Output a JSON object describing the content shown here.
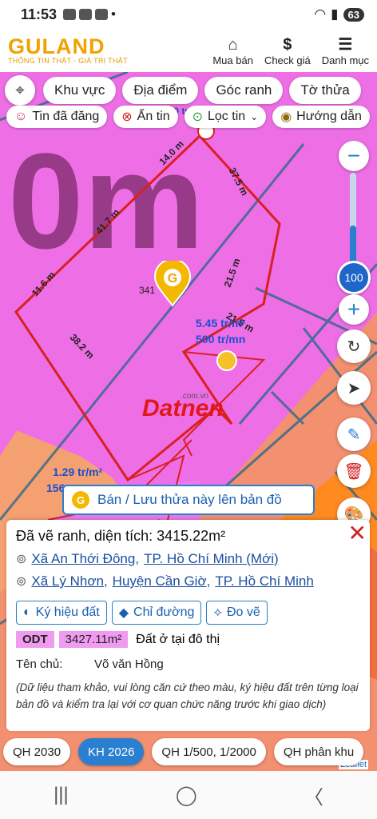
{
  "status": {
    "time": "11:53",
    "battery": "63"
  },
  "header": {
    "logo": "GULAND",
    "slogan": "THÔNG TIN THẬT - GIÁ TRỊ THẬT",
    "buttons": [
      {
        "label": "Mua bán",
        "icon": "house-icon"
      },
      {
        "label": "Check giá",
        "icon": "dollar-icon"
      },
      {
        "label": "Danh mục",
        "icon": "menu-icon"
      }
    ]
  },
  "filters": {
    "row1": [
      "Khu vực",
      "Địa điểm",
      "Góc ranh",
      "Tờ thửa"
    ],
    "row2": [
      "Tin đã đăng",
      "Ẩn tin",
      "Lọc tin",
      "Hướng dẫn"
    ]
  },
  "map": {
    "zoom_value": "100",
    "edge_labels": [
      "14.0 m",
      "37.5 m",
      "41.7 m",
      "21.5 m",
      "11.6 m",
      "38.2 m",
      "21.5 m"
    ],
    "price_label_1": "5.45 tr/m²",
    "price_label_2": "500 tr/mn",
    "price_label_3": "1.29 tr/m²",
    "parcel_number": "341",
    "watermark": "Datnen",
    "watermark_sub": ".com.vn",
    "cut_top_label": "500 tr/m",
    "cut_left_label": "156",
    "save_banner": "Bán / Lưu thửa này lên bản đồ",
    "leaflet": "Leaflet"
  },
  "panel": {
    "title": "Đã vẽ ranh, diện tích: 3415.22m²",
    "addr1_ward": "Xã An Thới Đông",
    "addr1_city": "TP. Hồ Chí Minh (Mới)",
    "addr2_ward": "Xã Lý Nhơn",
    "addr2_district": "Huyện Cần Giờ",
    "addr2_city": "TP. Hồ Chí Minh",
    "buttons": [
      "Ký hiệu đất",
      "Chỉ đường",
      "Đo vẽ"
    ],
    "land_code": "ODT",
    "land_area": "3427.11m²",
    "land_type": "Đất ở tại đô thị",
    "owner_label": "Tên chủ:",
    "owner_name": "Võ văn Hồng",
    "note": "(Dữ liệu tham khảo, vui lòng căn cứ theo màu, ký hiệu đất trên từng loại bản đồ và kiểm tra lại với cơ quan chức năng trước khi giao dịch)"
  },
  "tabs": [
    "QH 2030",
    "KH 2026",
    "QH 1/500, 1/2000",
    "QH phân khu"
  ],
  "colors": {
    "accent": "#2a7fd0",
    "brand": "#f0a300",
    "land": "#ee6ee6"
  }
}
